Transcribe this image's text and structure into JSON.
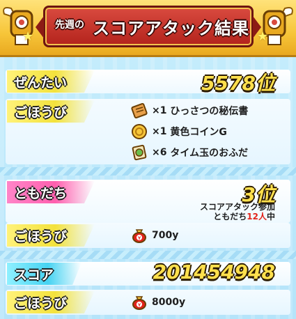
{
  "header": {
    "title_small": "先週の",
    "title_main": "スコアアタック結果"
  },
  "overall": {
    "label": "ぜんたい",
    "value": "5578位",
    "reward_label": "ごほうび",
    "rewards": [
      {
        "icon": "scroll-icon",
        "qty": "×1",
        "name": "ひっさつの秘伝書"
      },
      {
        "icon": "gold-coin-icon",
        "qty": "×1",
        "name": "黄色コインG"
      },
      {
        "icon": "time-talisman-icon",
        "qty": "×6",
        "name": "タイム玉のおふだ"
      }
    ]
  },
  "friends": {
    "label": "ともだち",
    "value": "3位",
    "note_line1": "スコアアタック参加",
    "note_line2_prefix": "ともだち",
    "note_line2_count": "12人",
    "note_line2_suffix": "中",
    "reward_label": "ごほうび",
    "reward": {
      "icon": "money-bag-icon",
      "amount": "700y"
    }
  },
  "score": {
    "label": "スコア",
    "value": "201454948",
    "reward_label": "ごほうび",
    "reward": {
      "icon": "money-bag-icon",
      "amount": "8000y"
    }
  },
  "colors": {
    "gold": "#ffe04d",
    "header_red": "#b3231c",
    "yellow_tag": "#f3e23c",
    "pink_tag": "#ff5fae",
    "cyan_tag": "#46d3f2",
    "highlight_red": "#e2231a"
  }
}
